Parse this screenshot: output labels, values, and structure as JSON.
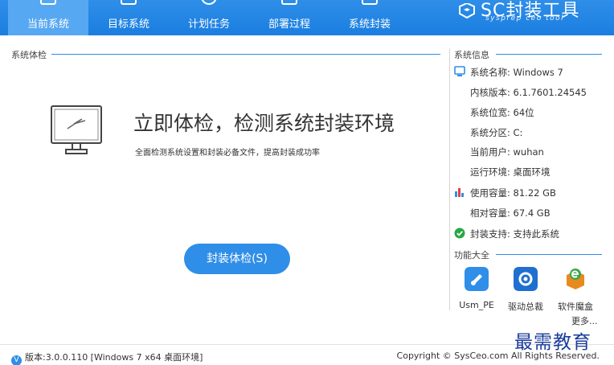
{
  "nav": {
    "tabs": [
      {
        "label": "当前系统",
        "active": true
      },
      {
        "label": "目标系统",
        "active": false
      },
      {
        "label": "计划任务",
        "active": false
      },
      {
        "label": "部署过程",
        "active": false
      },
      {
        "label": "系统封装",
        "active": false
      }
    ],
    "brand_title": "SC封装工具",
    "brand_subtitle": "sysprep ceo tool"
  },
  "check": {
    "section_title": "系统体检",
    "headline": "立即体检，检测系统封装环境",
    "subline": "全面检测系统设置和封装必备文件，提高封装成功率",
    "button_label": "封装体检(S)"
  },
  "info": {
    "section_title": "系统信息",
    "rows": [
      {
        "label": "系统名称:",
        "value": "Windows 7",
        "icon": "monitor-icon"
      },
      {
        "label": "内核版本:",
        "value": "6.1.7601.24545",
        "icon": ""
      },
      {
        "label": "系统位宽:",
        "value": "64位",
        "icon": ""
      },
      {
        "label": "系统分区:",
        "value": "C:",
        "icon": ""
      },
      {
        "label": "当前用户:",
        "value": "wuhan",
        "icon": ""
      },
      {
        "label": "运行环境:",
        "value": "桌面环境",
        "icon": ""
      },
      {
        "label": "使用容量:",
        "value": "81.22 GB",
        "icon": "bar-chart-icon"
      },
      {
        "label": "相对容量:",
        "value": "67.4 GB",
        "icon": ""
      },
      {
        "label": "封装支持:",
        "value": "支持此系统",
        "icon": "check-circle-icon"
      }
    ]
  },
  "functions": {
    "section_title": "功能大全",
    "items": [
      {
        "label": "Usm_PE",
        "icon": "usm-pe-icon",
        "color": "#2f8ee8"
      },
      {
        "label": "驱动总裁",
        "icon": "driver-gear-icon",
        "color": "#1f6fd0"
      },
      {
        "label": "软件魔盒",
        "icon": "magic-box-icon",
        "color": "#3aa84a"
      }
    ],
    "more_label": "更多..."
  },
  "footer": {
    "version": "版本:3.0.0.110 [Windows 7 x64 桌面环境]",
    "copyright": "Copyright © SysCeo.com All Rights Reserved."
  },
  "watermark": "最需教育",
  "colors": {
    "accent": "#2f8ee8",
    "active_tab": "#57a8f2",
    "success": "#27a844"
  }
}
